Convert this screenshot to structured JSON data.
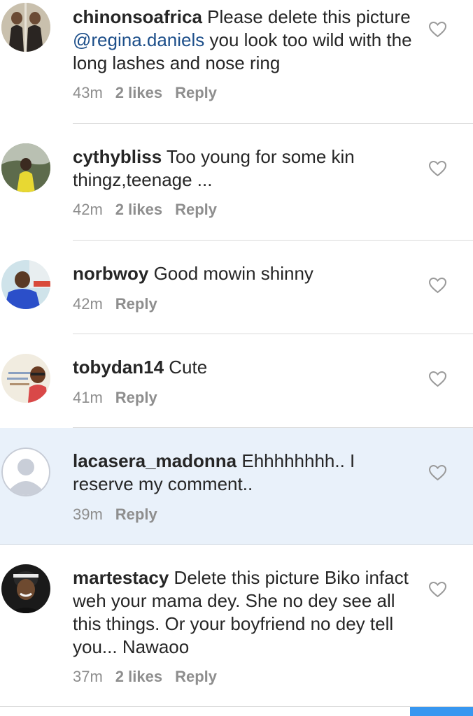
{
  "comments": [
    {
      "username": "chinonsoafrica",
      "text_before": " Please delete this picture ",
      "mention": "@regina.daniels",
      "text_after": " you look too wild with the long lashes and nose ring",
      "time": "43m",
      "likes": "2 likes",
      "reply": "Reply",
      "avatar_icon": "profile-photo"
    },
    {
      "username": "cythybliss",
      "text": " Too young for some kin thingz,teenage ...",
      "time": "42m",
      "likes": "2 likes",
      "reply": "Reply",
      "avatar_icon": "profile-photo"
    },
    {
      "username": "norbwoy",
      "text": " Good mowin shinny",
      "time": "42m",
      "reply": "Reply",
      "avatar_icon": "profile-photo"
    },
    {
      "username": "tobydan14",
      "text": " Cute",
      "time": "41m",
      "reply": "Reply",
      "avatar_icon": "profile-photo"
    },
    {
      "username": "lacasera_madonna",
      "text": " Ehhhhhhhh.. I reserve my comment..",
      "time": "39m",
      "reply": "Reply",
      "avatar_icon": "default-avatar"
    },
    {
      "username": "martestacy",
      "text": " Delete this picture Biko infact weh your mama dey.  She no dey see all this things. Or your boyfriend no dey tell you... Nawaoo",
      "time": "37m",
      "likes": "2 likes",
      "reply": "Reply",
      "avatar_icon": "profile-photo"
    }
  ],
  "icons": {
    "like": "heart-outline-icon"
  },
  "colors": {
    "text": "#262626",
    "meta": "#8e8e8e",
    "mention": "#1d4f8a",
    "highlight": "#e9f1fa",
    "accent": "#3897f0"
  }
}
